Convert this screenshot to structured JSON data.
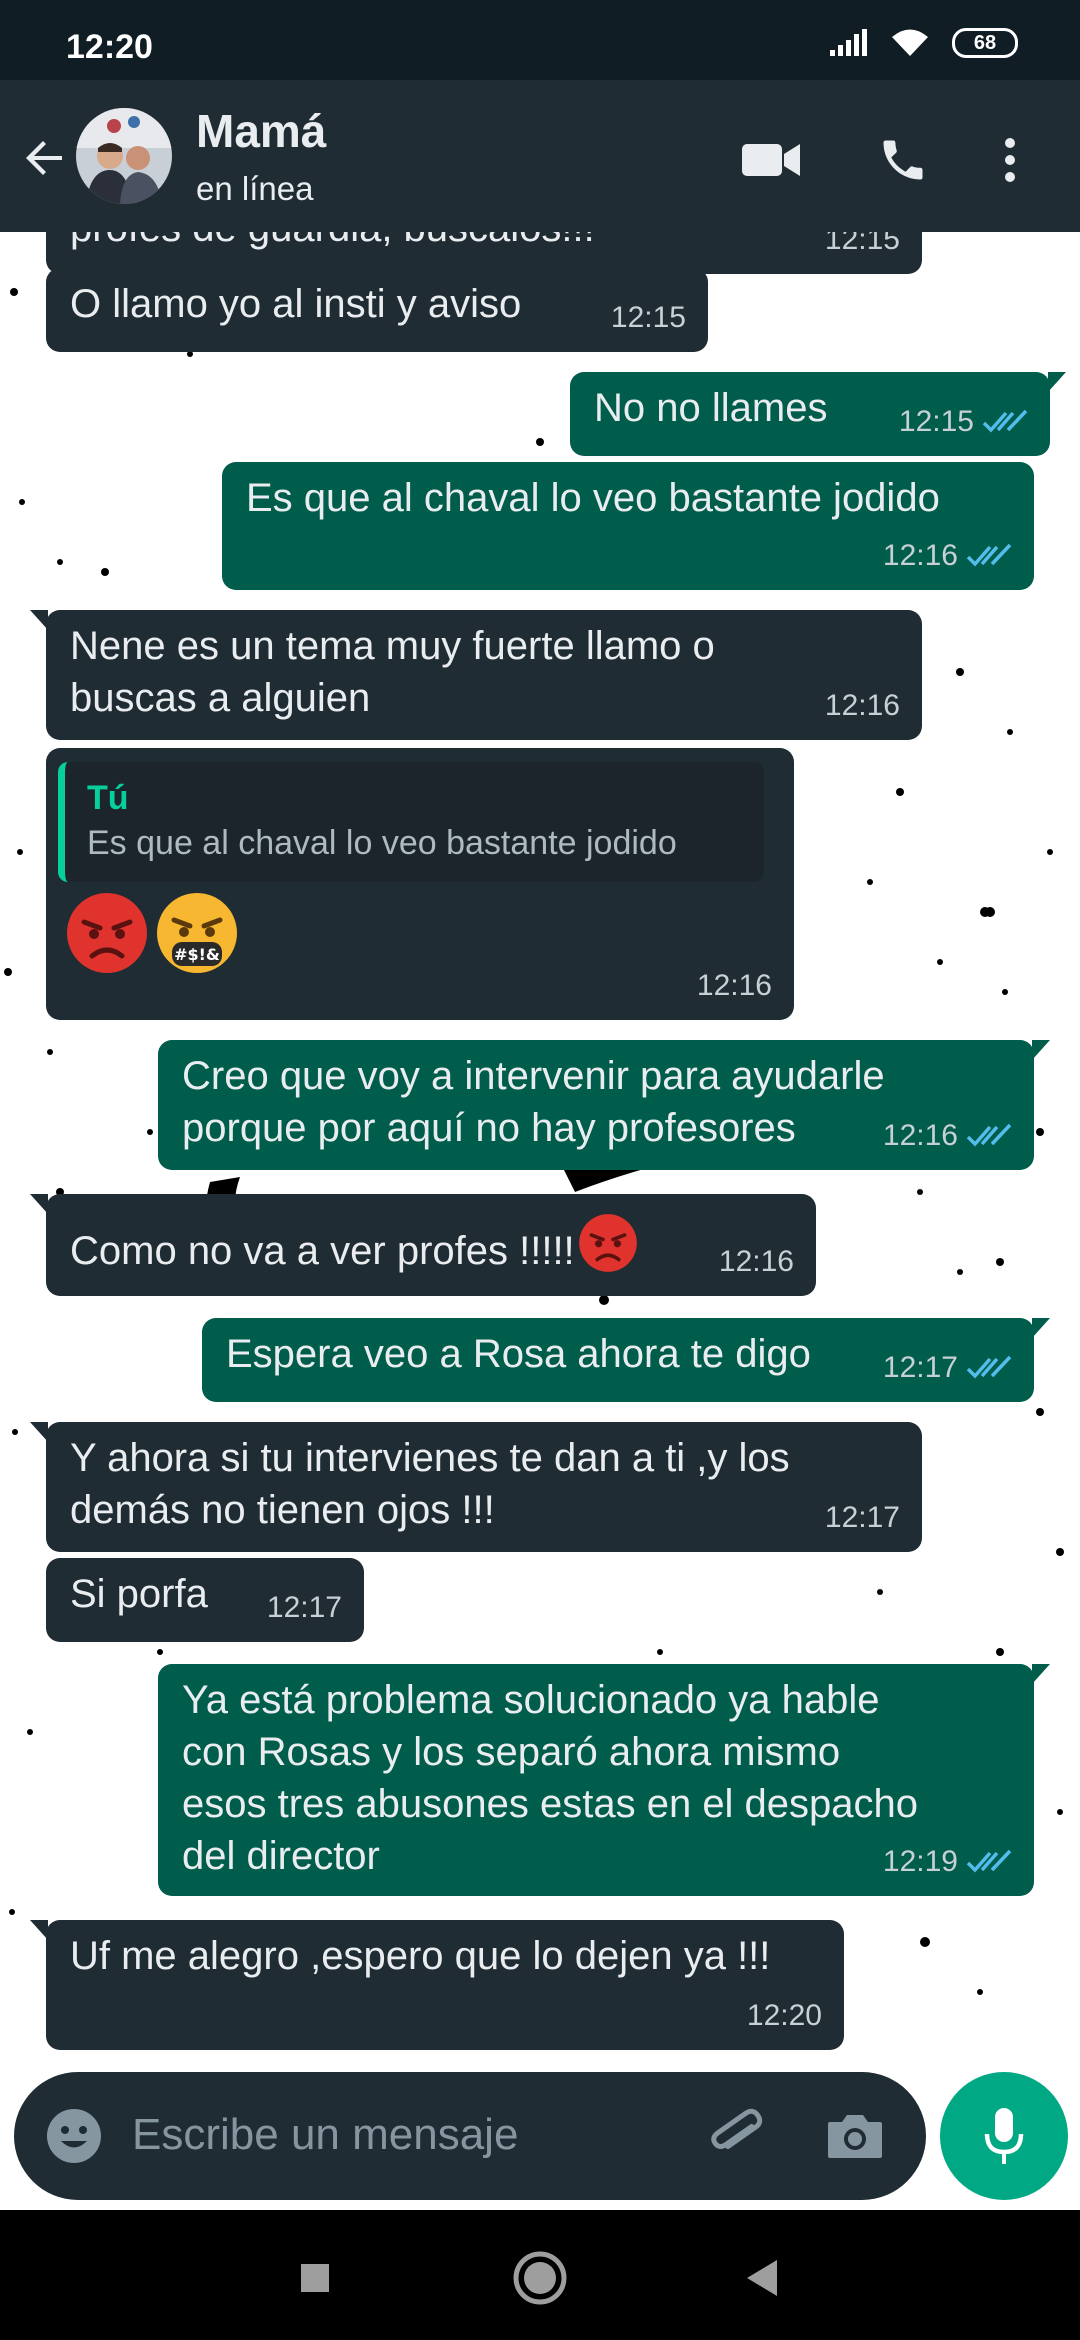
{
  "status_bar": {
    "time": "12:20",
    "battery": "68"
  },
  "header": {
    "name": "Mamá",
    "status": "en línea"
  },
  "messages": [
    {
      "dir": "in",
      "text": "profes de guardia, buscalos!!!",
      "time": "12:15"
    },
    {
      "dir": "in",
      "text": "O llamo yo al insti y aviso",
      "time": "12:15"
    },
    {
      "dir": "out",
      "text": "No no llames",
      "time": "12:15"
    },
    {
      "dir": "out",
      "text": "Es que al chaval lo veo bastante jodido",
      "time": "12:16"
    },
    {
      "dir": "in",
      "text": "Nene es un tema muy fuerte llamo o\nbuscas a alguien",
      "time": "12:16"
    },
    {
      "dir": "in",
      "quote_author": "Tú",
      "quote_text": "Es que al chaval lo veo bastante jodido",
      "emoji": "😡🤬",
      "time": "12:16"
    },
    {
      "dir": "out",
      "text": "Creo que voy a intervenir para ayudarle\nporque por aquí no hay profesores",
      "time": "12:16"
    },
    {
      "dir": "in",
      "text": "Como no va a ver profes !!!!!",
      "emoji": "😡",
      "time": "12:16"
    },
    {
      "dir": "out",
      "text": "Espera veo a Rosa ahora te digo",
      "time": "12:17"
    },
    {
      "dir": "in",
      "text": "Y ahora si tu intervienes te dan a ti ,y los\ndemás no tienen ojos !!!",
      "time": "12:17"
    },
    {
      "dir": "in",
      "text": "Si porfa",
      "time": "12:17"
    },
    {
      "dir": "out",
      "text": "Ya está problema solucionado ya hable\ncon Rosas y los separó ahora mismo\nesos tres abusones estas en el despacho\ndel director",
      "time": "12:19"
    },
    {
      "dir": "in",
      "text": "Uf me alegro ,espero que lo dejen ya !!!",
      "time": "12:20"
    }
  ],
  "input": {
    "placeholder": "Escribe un mensaje"
  },
  "colors": {
    "incoming": "#202c33",
    "outgoing": "#005c4b",
    "accent": "#00a884",
    "read_ticks": "#53bdeb"
  },
  "icons": [
    "back-arrow-icon",
    "video-call-icon",
    "phone-icon",
    "more-vert-icon",
    "emoji-icon",
    "attach-icon",
    "camera-icon",
    "mic-icon",
    "nav-square-icon",
    "nav-circle-icon",
    "nav-back-icon"
  ]
}
